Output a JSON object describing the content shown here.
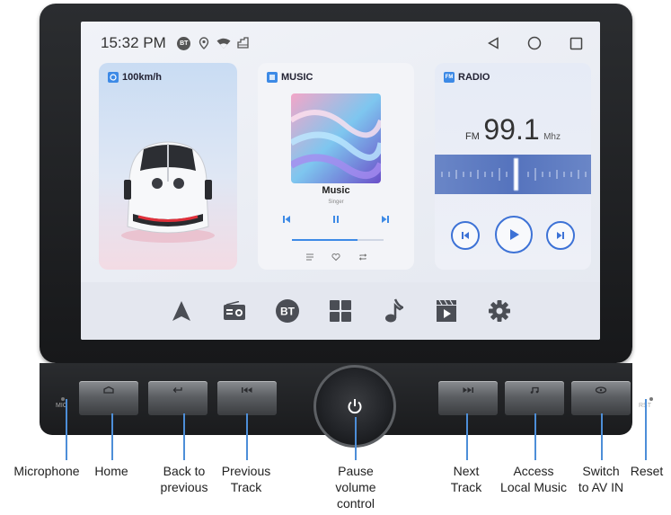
{
  "status_bar": {
    "time": "15:32 PM",
    "icons": [
      "bt-icon",
      "location-icon",
      "wifi-icon",
      "signal-icon"
    ],
    "bt_text": "BT",
    "nav_keys": [
      "back-triangle-icon",
      "home-circle-icon",
      "recents-square-icon"
    ]
  },
  "speed_card": {
    "title": "100km/h",
    "icon": "speed-icon"
  },
  "music_card": {
    "title": "MUSIC",
    "song": "Music",
    "artist": "Singer",
    "progress": 0.72,
    "controls": [
      "previous-icon",
      "pause-icon",
      "next-icon"
    ],
    "options": [
      "playlist-icon",
      "heart-icon",
      "repeat-icon"
    ]
  },
  "radio_card": {
    "title": "RADIO",
    "band": "FM",
    "frequency": "99.1",
    "unit": "Mhz",
    "tag_text": "FM"
  },
  "dock": {
    "items": [
      "navigation-icon",
      "radio-icon",
      "bluetooth-icon",
      "apps-icon",
      "music-note-icon",
      "video-icon",
      "settings-icon"
    ],
    "bt_text": "BT"
  },
  "hardware": {
    "mic_label": "MIC",
    "rst_label": "RST",
    "buttons": [
      "home-icon",
      "back-icon",
      "previous-track-icon",
      "next-track-icon",
      "local-music-icon",
      "av-in-icon"
    ],
    "knob_icon": "power-icon"
  },
  "callouts": {
    "microphone": "Microphone",
    "home": "Home",
    "back_1": "Back to",
    "back_2": "previous",
    "prev_1": "Previous",
    "prev_2": "Track",
    "pause_1": "Pause",
    "pause_2": "volume",
    "pause_3": "control",
    "next_1": "Next",
    "next_2": "Track",
    "access_1": "Access",
    "access_2": "Local Music",
    "switch_1": "Switch",
    "switch_2": "to AV IN",
    "reset": "Reset"
  },
  "colors": {
    "accent": "#3d8ae6",
    "callout_line": "#4d8ed8",
    "bezel": "#1f2023"
  }
}
